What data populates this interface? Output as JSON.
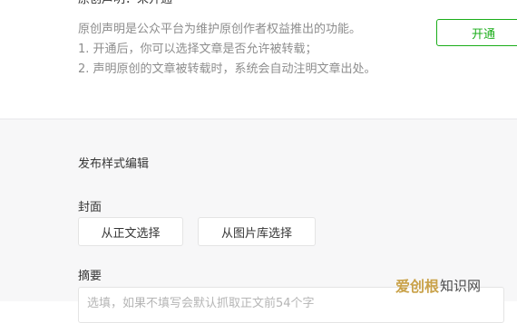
{
  "original": {
    "status": "原创声明：未开通",
    "description": "原创声明是公众平台为维护原创作者权益推出的功能。",
    "point1": "1. 开通后，你可以选择文章是否允许被转载；",
    "point2": "2. 声明原创的文章被转载时，系统会自动注明文章出处。",
    "open_button": "开通"
  },
  "publish_style": {
    "title": "发布样式编辑",
    "cover_label": "封面",
    "cover_from_body": "从正文选择",
    "cover_from_library": "从图片库选择",
    "summary_label": "摘要",
    "summary_placeholder": "选填，如果不填写会默认抓取正文前54个字"
  },
  "watermark": {
    "logo": "爱创根",
    "text": "知识网"
  },
  "colors": {
    "accent": "#1aad19",
    "secondary_text": "#8d8d8d",
    "panel_background": "#f7f7f8"
  }
}
